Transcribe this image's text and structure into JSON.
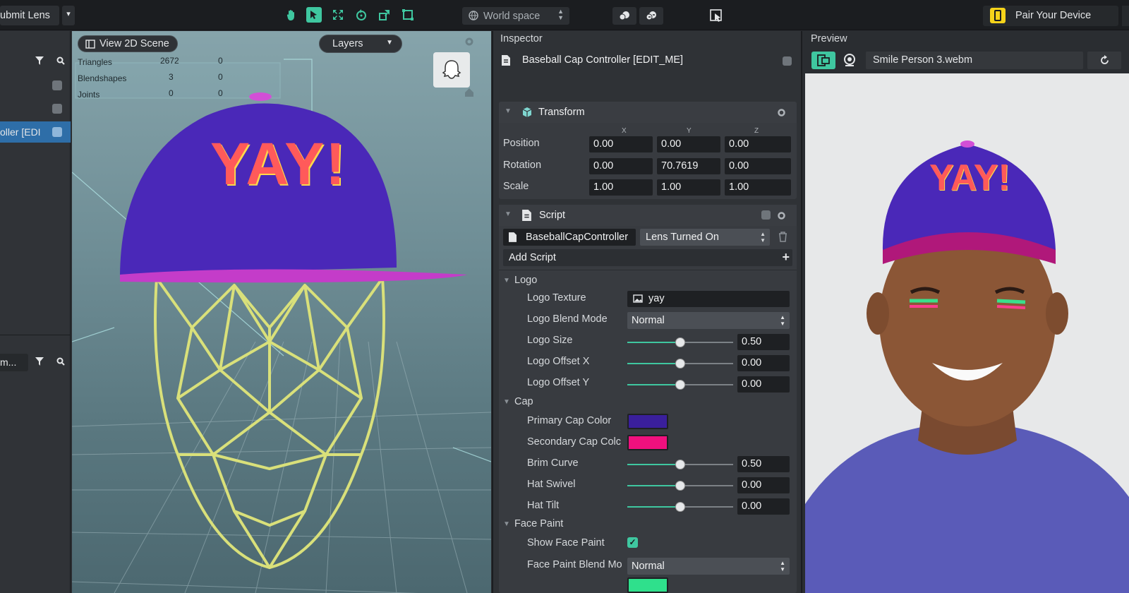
{
  "topbar": {
    "submit_label": "ubmit Lens",
    "space_label": "World space",
    "pair_label": "Pair Your Device"
  },
  "left_panel": {
    "row_label": "oller [EDI",
    "search_stub": "m..."
  },
  "viewport": {
    "view2d_label": "View 2D Scene",
    "layers_label": "Layers",
    "stats": [
      {
        "name": "Triangles",
        "a": "2672",
        "b": "0"
      },
      {
        "name": "Blendshapes",
        "a": "3",
        "b": "0"
      },
      {
        "name": "Joints",
        "a": "0",
        "b": "0"
      }
    ],
    "logo_text": "YAY!"
  },
  "inspector": {
    "title": "Inspector",
    "object_name": "Baseball Cap Controller [EDIT_ME]",
    "transform": {
      "title": "Transform",
      "axes": [
        "X",
        "Y",
        "Z"
      ],
      "rows": [
        {
          "label": "Position",
          "values": [
            "0.00",
            "0.00",
            "0.00"
          ]
        },
        {
          "label": "Rotation",
          "values": [
            "0.00",
            "70.7619",
            "0.00"
          ]
        },
        {
          "label": "Scale",
          "values": [
            "1.00",
            "1.00",
            "1.00"
          ]
        }
      ]
    },
    "script": {
      "title": "Script",
      "script_name": "BaseballCapController",
      "event": "Lens Turned On",
      "add_script": "Add Script"
    },
    "logo_group": {
      "title": "Logo",
      "texture_label": "Logo Texture",
      "texture_value": "yay",
      "blend_label": "Logo Blend Mode",
      "blend_value": "Normal",
      "size_label": "Logo Size",
      "size_value": "0.50",
      "offx_label": "Logo Offset X",
      "offx_value": "0.00",
      "offy_label": "Logo Offset Y",
      "offy_value": "0.00"
    },
    "cap_group": {
      "title": "Cap",
      "primary_label": "Primary Cap Color",
      "primary_color": "#3a1f9c",
      "secondary_label": "Secondary Cap Colc",
      "secondary_color": "#f0107e",
      "brim_label": "Brim Curve",
      "brim_value": "0.50",
      "swivel_label": "Hat Swivel",
      "swivel_value": "0.00",
      "tilt_label": "Hat Tilt",
      "tilt_value": "0.00"
    },
    "face_group": {
      "title": "Face Paint",
      "show_label": "Show Face Paint",
      "blend_label": "Face Paint Blend Mo",
      "blend_value": "Normal",
      "color_swatch": "#2fe08c"
    }
  },
  "preview": {
    "title": "Preview",
    "file_name": "Smile Person 3.webm",
    "logo_text": "YAY!"
  }
}
